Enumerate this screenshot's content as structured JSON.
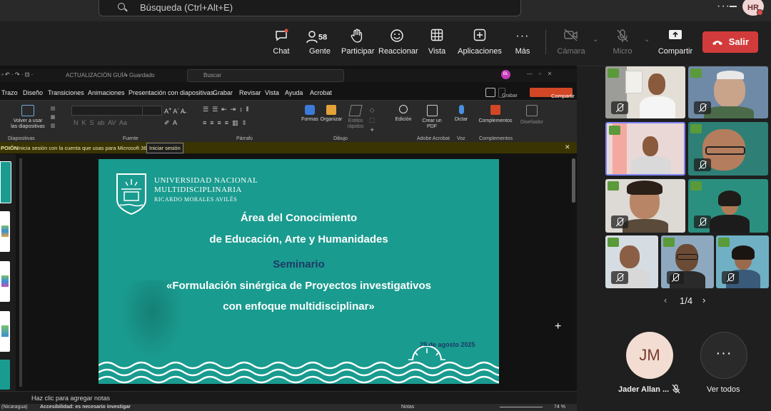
{
  "search": {
    "placeholder": "Búsqueda (Ctrl+Alt+E)"
  },
  "user": {
    "initials": "HR"
  },
  "toolbar": {
    "chat": "Chat",
    "people": "Gente",
    "people_count": "58",
    "raise": "Participar",
    "react": "Reaccionar",
    "view": "Vista",
    "apps": "Aplicaciones",
    "more": "Más",
    "camera": "Cámara",
    "mic": "Micro",
    "share": "Compartir",
    "leave": "Salir"
  },
  "powerpoint": {
    "titlebar": {
      "file": "ACTUALIZACIÓN GUÍA",
      "saved": "• Guardado",
      "search": "Buscar",
      "user": "BL"
    },
    "tabs": [
      "Trazo",
      "Diseño",
      "Transiciones",
      "Animaciones",
      "Presentación con diapositivas",
      "Grabar",
      "Revisar",
      "Vista",
      "Ayuda",
      "Acrobat"
    ],
    "record_btn": "Grabar",
    "share_btn": "Compartir",
    "ribbon": {
      "reuse": "Volver a usar las diapositivas",
      "groups": [
        "Diapositivas",
        "Fuente",
        "Párrafo",
        "Dibujo",
        "Adobe Acrobat",
        "Voz",
        "Complementos"
      ],
      "shapes": "Formas",
      "arrange": "Organizar",
      "quick_styles": "Estilos rápidos",
      "edit": "Edición",
      "create_pdf": "Crear un PDF",
      "dictate": "Dictar",
      "addins": "Complementos",
      "designer": "Diseñador"
    },
    "message": {
      "tag": "POIÓN",
      "text": "Inicia sesión con la cuenta que usas para Microsoft 365",
      "button": "Iniciar sesión"
    },
    "notes": "Haz clic para agregar notas",
    "status": {
      "lang": "(Nicaragua)",
      "access": "Accesibilidad: es necesario investigar",
      "notes": "Notas",
      "zoom": "74 %"
    }
  },
  "slide": {
    "logo_line1": "UNIVERSIDAD NACIONAL",
    "logo_line2": "MULTIDISCIPLINARIA",
    "logo_line3": "RICARDO MORALES AVILÉS",
    "title1": "Área del Conocimiento",
    "title2": "de Educación, Arte y Humanidades",
    "seminar": "Seminario",
    "topic1": "«Formulación sinérgica de Proyectos investigativos",
    "topic2": "con enfoque multidisciplinar»",
    "date": "29 de agosto 2025"
  },
  "gallery": {
    "page": "1/4",
    "bottom": [
      {
        "initials": "JM",
        "name": "Jader Allan ..."
      },
      {
        "name": "Ver todos"
      }
    ]
  },
  "colors": {
    "leave": "#d23b3b",
    "slide_bg": "#1a9b8f",
    "seminar": "#1d3a66",
    "accent_orange": "#d24726"
  }
}
